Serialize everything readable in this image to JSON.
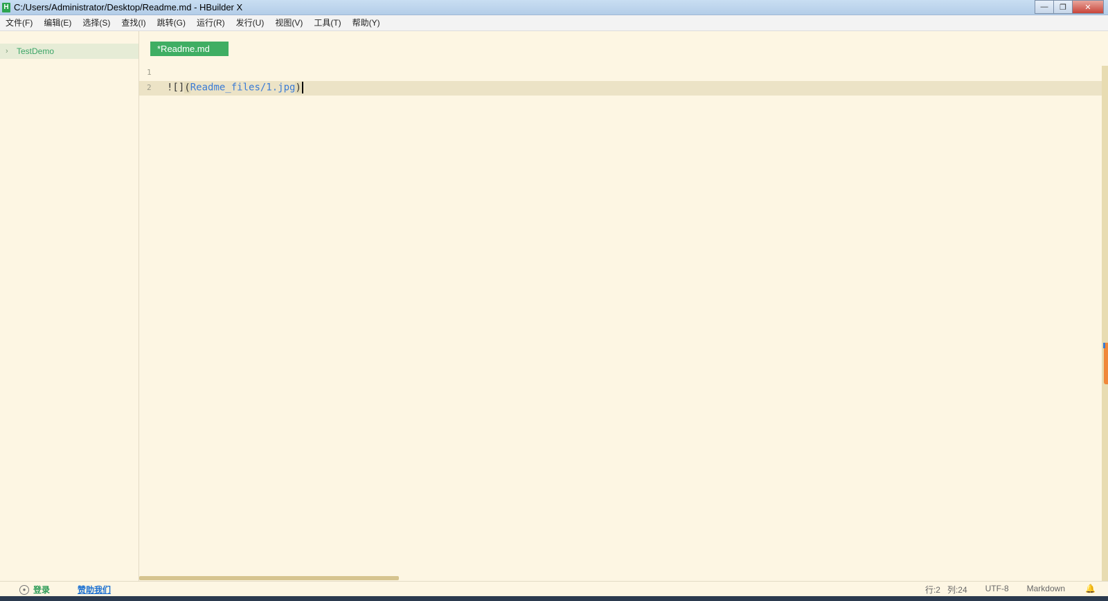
{
  "window": {
    "title": "C:/Users/Administrator/Desktop/Readme.md - HBuilder X",
    "app_icon_letter": "H",
    "buttons": {
      "minimize": "—",
      "restore": "❐",
      "close": "✕"
    }
  },
  "menu": [
    "文件(F)",
    "编辑(E)",
    "选择(S)",
    "查找(I)",
    "跳转(G)",
    "运行(R)",
    "发行(U)",
    "视图(V)",
    "工具(T)",
    "帮助(Y)"
  ],
  "sidebar": {
    "project": "TestDemo",
    "chevron": "›"
  },
  "editor": {
    "tab_label": "*Readme.md",
    "lines": [
      {
        "number": "1",
        "text": ""
      },
      {
        "number": "2",
        "prefix": "![]",
        "open_paren": "(",
        "link": "Readme_files/1.jpg",
        "close_paren": ")"
      }
    ]
  },
  "statusbar": {
    "login": "登录",
    "sponsor": "赞助我们",
    "row": "行:2",
    "col": "列:24",
    "encoding": "UTF-8",
    "language": "Markdown"
  },
  "colors": {
    "accent": "#3fae63",
    "background": "#fdf6e3",
    "link": "#3a7bd5"
  }
}
